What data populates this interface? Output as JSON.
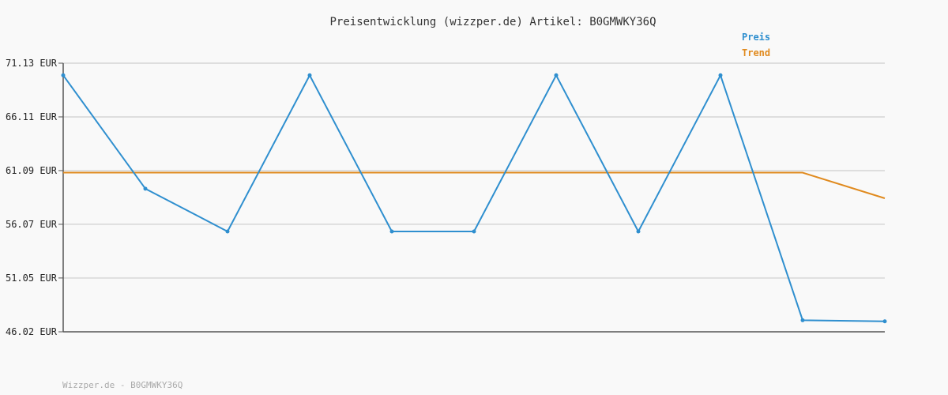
{
  "chart_data": {
    "type": "line",
    "title": "Preisentwicklung (wizzper.de) Artikel: B0GMWKY36Q",
    "xlabel": "",
    "ylabel": "",
    "ylim": [
      46.02,
      71.13
    ],
    "y_ticks": [
      "71.13 EUR",
      "66.11 EUR",
      "61.09 EUR",
      "56.07 EUR",
      "51.05 EUR",
      "46.02 EUR"
    ],
    "y_tick_values": [
      71.13,
      66.11,
      61.09,
      56.07,
      51.05,
      46.02
    ],
    "grid": true,
    "legend_position": "top-right",
    "series": [
      {
        "name": "Preis",
        "color": "#2f8fcf",
        "values": [
          70.0,
          59.4,
          55.4,
          70.0,
          55.4,
          55.4,
          70.0,
          55.4,
          70.0,
          47.1,
          47.0
        ],
        "markers": true
      },
      {
        "name": "Trend",
        "color": "#e08a1e",
        "values": [
          60.9,
          60.9,
          60.9,
          60.9,
          60.9,
          60.9,
          60.9,
          60.9,
          60.9,
          60.9,
          58.5
        ],
        "markers": false
      }
    ]
  },
  "footer": "Wizzper.de - B0GMWKY36Q"
}
